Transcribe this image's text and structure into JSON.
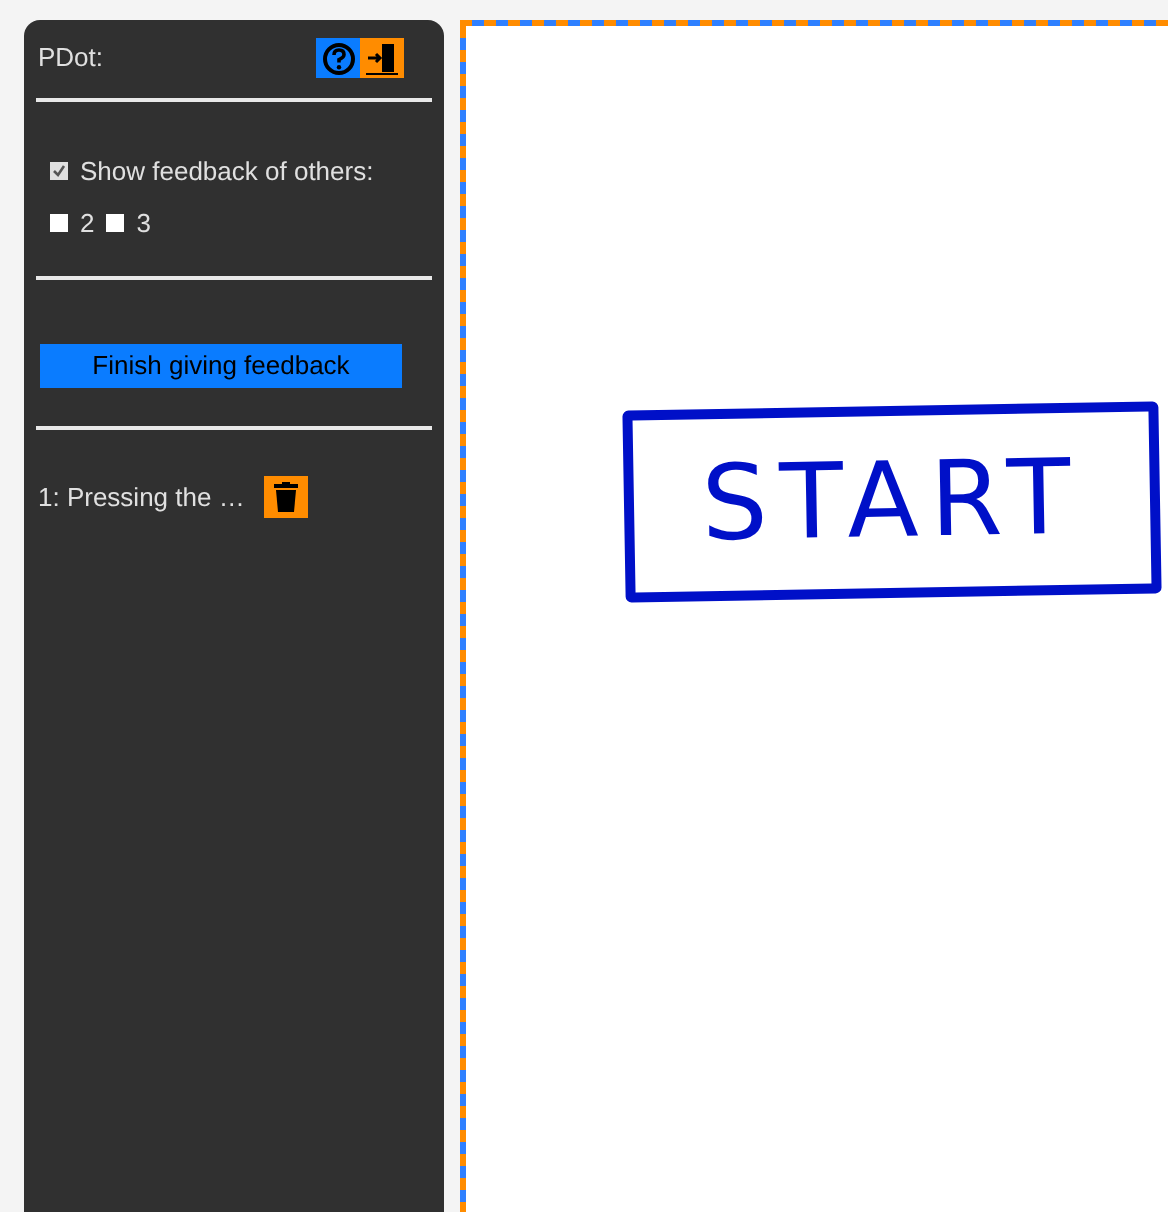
{
  "panel": {
    "title": "PDot:",
    "show_others": {
      "label": "Show feedback of others:",
      "checked": true
    },
    "participants": [
      {
        "label": "2",
        "checked": false
      },
      {
        "label": "3",
        "checked": false
      }
    ],
    "finish_button": "Finish giving feedback",
    "feedback_items": [
      {
        "text": "1: Pressing the …"
      }
    ]
  },
  "canvas": {
    "sketch_text": "START"
  }
}
